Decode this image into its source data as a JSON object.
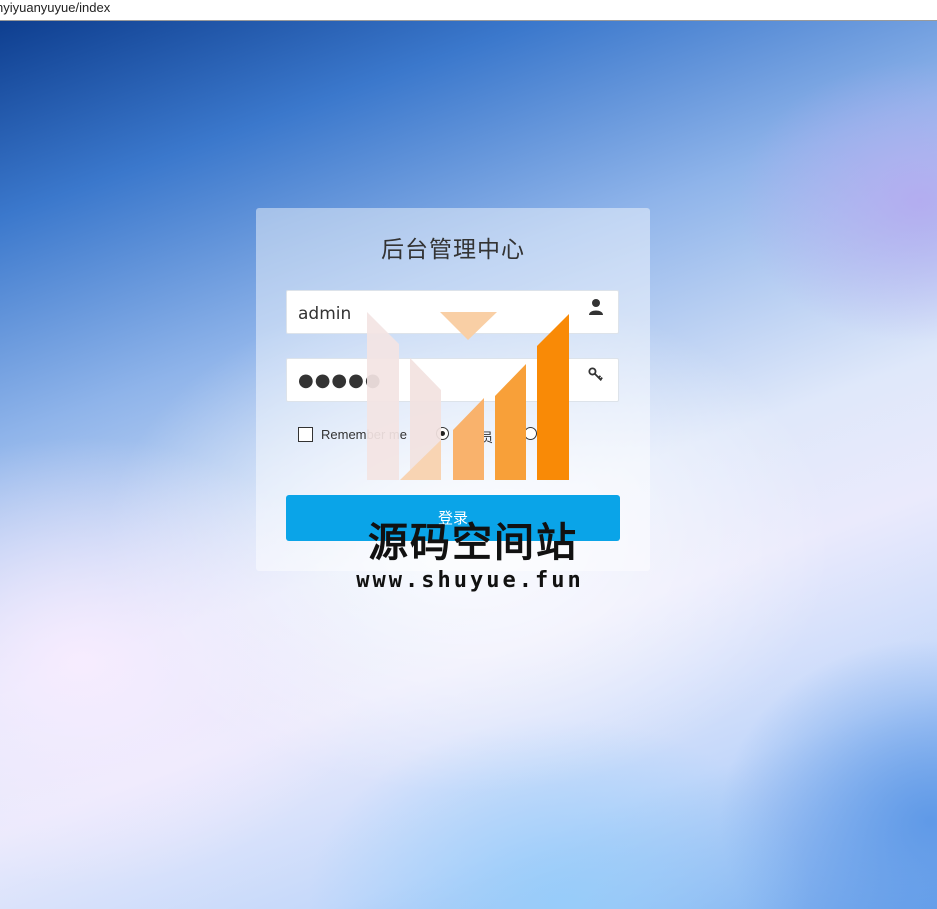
{
  "browser": {
    "url": "nyiyuanyuyue/index"
  },
  "login": {
    "title": "后台管理中心",
    "username_value": "admin",
    "password_mask": "●●●●●",
    "remember_label": "Remember me",
    "role_admin_label": "管理员",
    "role_user_label": "用户",
    "submit_label": "登录"
  },
  "watermark": {
    "title": "源码空间站",
    "url": "www.shuyue.fun"
  },
  "colors": {
    "button": "#0aa4e8",
    "watermark_orange": "#f98a06"
  }
}
